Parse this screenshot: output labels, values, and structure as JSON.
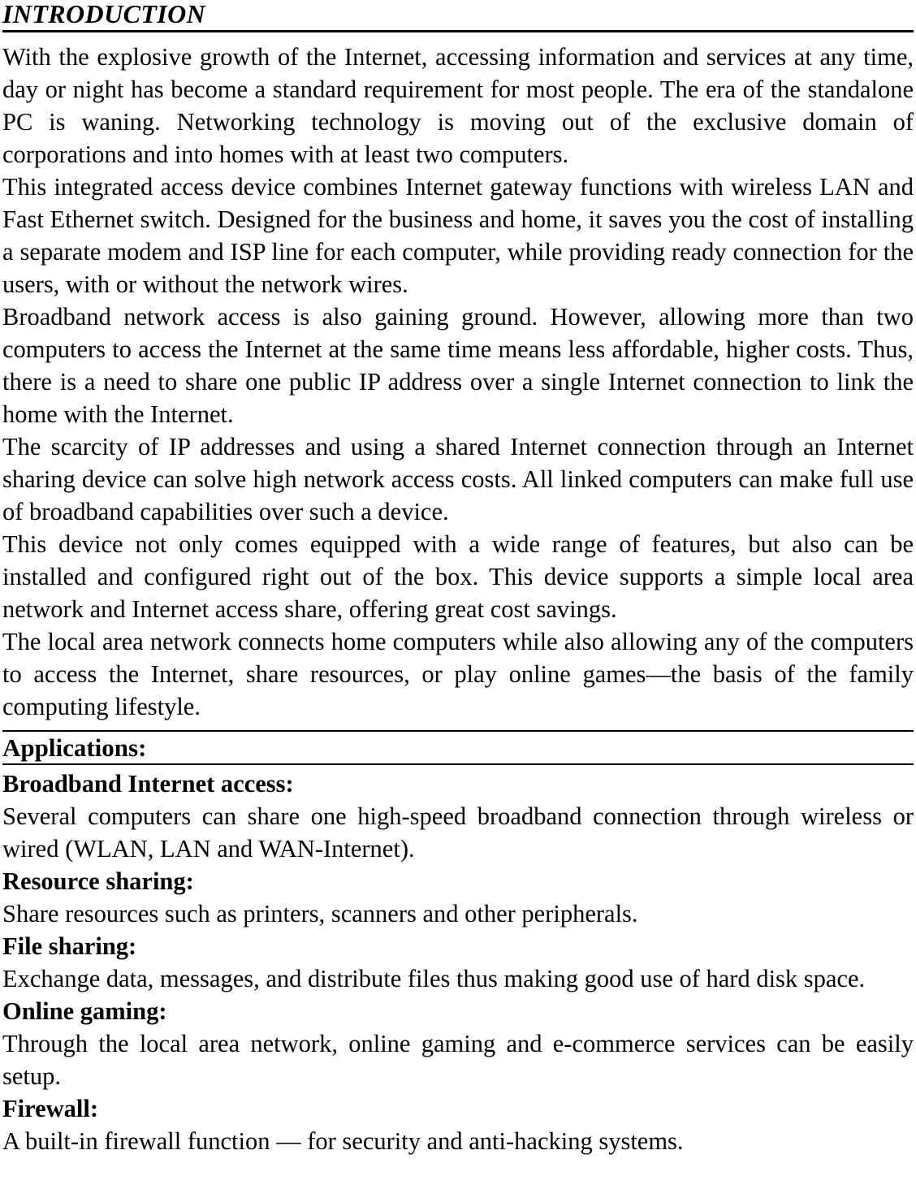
{
  "document": {
    "title": "INTRODUCTION",
    "paragraphs": [
      "With the explosive growth of the Internet, accessing information and services at any time, day or night has become a standard requirement for most people. The era of the standalone PC is waning. Networking technology is moving out of the exclusive domain of corporations and into homes with at least two computers.",
      "This integrated access device combines Internet gateway functions with wireless LAN and Fast Ethernet switch. Designed for the business and home, it saves you the cost of installing a separate modem and ISP line for each computer, while providing ready connection for the users, with or without the network wires.",
      "Broadband network access is also gaining ground. However, allowing more than two computers to access the Internet at the same time means less affordable, higher costs. Thus, there is a need to share one public IP address over a single Internet connection to link the home with the Internet.",
      "The scarcity of IP addresses and using a shared Internet connection through an Internet sharing device can solve high network access costs. All linked computers can make full use of broadband capabilities over such a device.",
      "This device not only comes equipped with a wide range of features, but also can be installed and configured right out of the box. This device supports a simple local area network and Internet access share, offering great cost savings.",
      "The local area network connects home computers while also allowing any of the computers to access the Internet, share resources, or play online games—the basis of the family computing lifestyle."
    ],
    "applications": {
      "heading": "Applications:",
      "items": [
        {
          "title": "Broadband Internet access:",
          "text": "Several computers can share one high-speed broadband connection through wireless or wired (WLAN, LAN and WAN-Internet)."
        },
        {
          "title": "Resource sharing:",
          "text": "Share resources such as printers, scanners and other peripherals."
        },
        {
          "title": "File sharing:",
          "text": "Exchange data, messages, and distribute files thus making good use of hard disk space."
        },
        {
          "title": "Online gaming:",
          "text": "Through the local area network, online gaming and e-commerce services can be easily setup."
        },
        {
          "title": "Firewall:",
          "text": "A built-in firewall function — for security and anti-hacking systems."
        }
      ]
    }
  }
}
